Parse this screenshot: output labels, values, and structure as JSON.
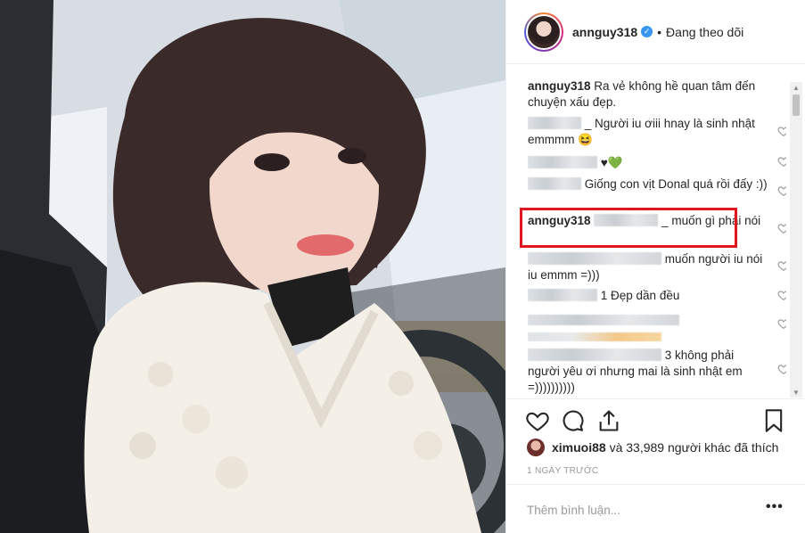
{
  "post": {
    "username": "annguy318",
    "follow_state": "Đang theo dõi",
    "separator": "•",
    "verified_mark": "✓"
  },
  "caption": {
    "username": "annguy318",
    "text": "Ra vẻ không hề quan tâm đến chuyện xấu đẹp."
  },
  "comments": [
    {
      "text_prefix": "_ ",
      "text": "Người iu ơiii hnay là sinh nhật emmmm 😆"
    },
    {
      "text": "♥💚"
    },
    {
      "text": "Giống con vịt Donal quá rồi đấy :))"
    },
    {
      "username": "annguy318",
      "text_prefix": "_ ",
      "text": "muốn gì phải nói"
    },
    {
      "text": "muốn người iu nói iu emmm =)))"
    },
    {
      "text": "1 Đẹp dần đều"
    },
    {
      "text": ""
    },
    {
      "text": "3 không phải người yêu ơi nhưng mai là sinh nhật em =))))))))))"
    }
  ],
  "likes": {
    "user": "ximuoi88",
    "text": " và 33,989 người khác đã thích"
  },
  "time_ago": "1 NGÀY TRƯỚC",
  "add_comment": {
    "placeholder": "Thêm bình luận..."
  },
  "more": "•••",
  "icons": [
    "heart-icon",
    "comment-icon",
    "share-icon",
    "bookmark-icon"
  ],
  "colors": {
    "highlight": "#e0181e",
    "verified": "#3897f0",
    "muted": "#999999"
  }
}
